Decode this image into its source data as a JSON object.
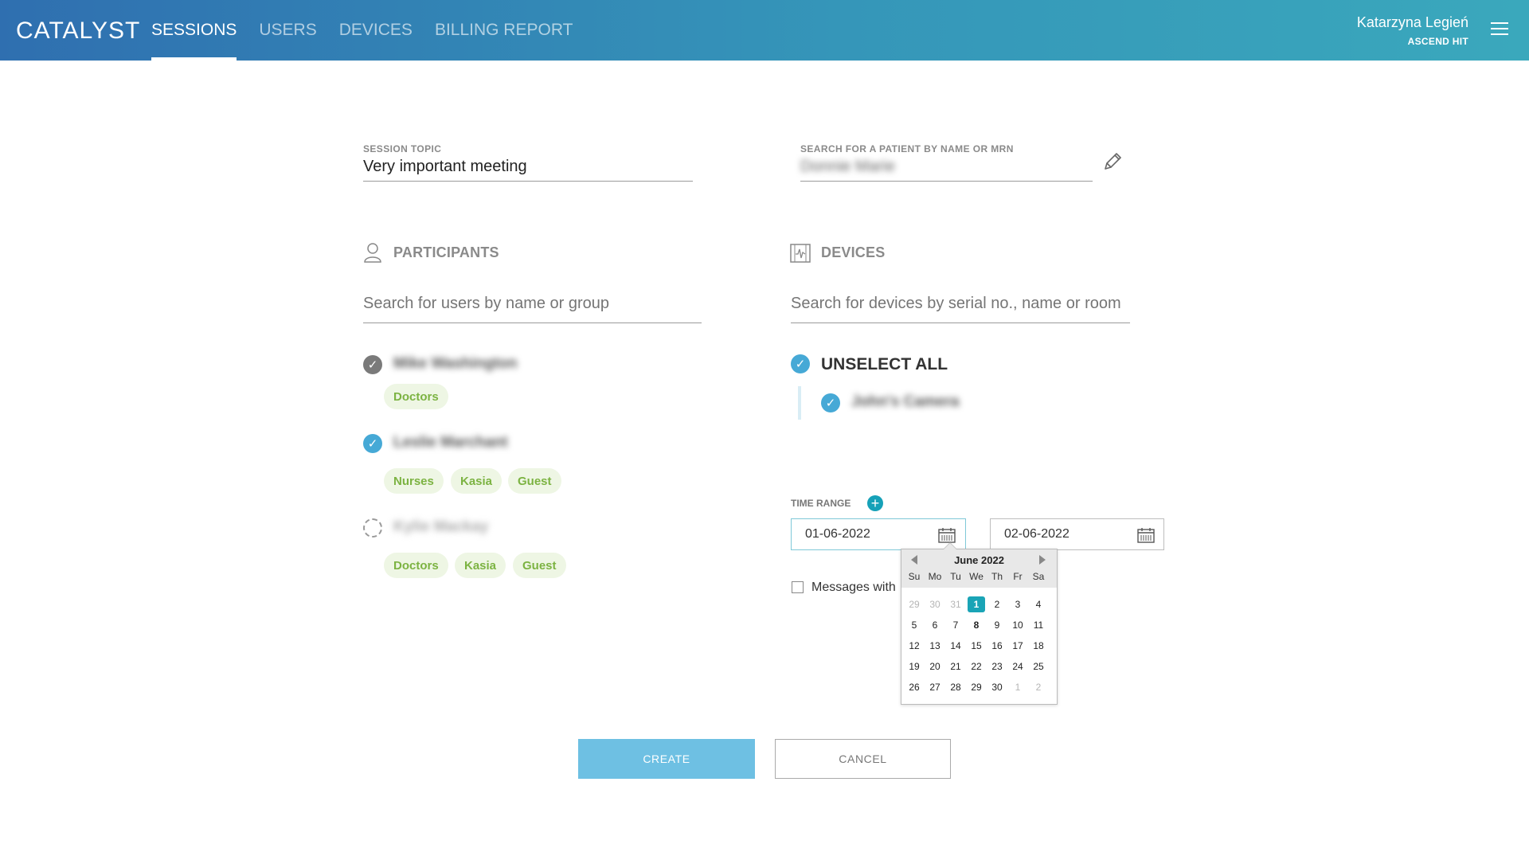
{
  "header": {
    "logo": "CATALYST",
    "nav": [
      "SESSIONS",
      "USERS",
      "DEVICES",
      "BILLING REPORT"
    ],
    "active_nav": "SESSIONS",
    "user_name": "Katarzyna Legień",
    "user_org": "ASCEND HIT"
  },
  "session": {
    "topic_label": "SESSION TOPIC",
    "topic_value": "Very important meeting",
    "patient_label": "SEARCH FOR A PATIENT BY NAME OR MRN",
    "patient_value": "Donnie Marie"
  },
  "participants": {
    "title": "PARTICIPANTS",
    "search_placeholder": "Search for users by name or group",
    "people": [
      {
        "name": "Mike Washington",
        "state": "checked-grey",
        "tags": [
          "Doctors"
        ]
      },
      {
        "name": "Leslie Marchant",
        "state": "checked-blue",
        "tags": [
          "Nurses",
          "Kasia",
          "Guest"
        ]
      },
      {
        "name": "Kylie Mackay",
        "state": "unchecked",
        "tags": [
          "Doctors",
          "Kasia",
          "Guest"
        ]
      }
    ]
  },
  "devices": {
    "title": "DEVICES",
    "search_placeholder": "Search for devices by serial no., name or room",
    "unselect_all": "UNSELECT ALL",
    "items": [
      {
        "name": "John's Camera",
        "checked": true
      }
    ]
  },
  "time_range": {
    "label": "TIME RANGE",
    "start": "01-06-2022",
    "end": "02-06-2022",
    "messages_label": "Messages with"
  },
  "calendar": {
    "month": "June 2022",
    "weekdays": [
      "Su",
      "Mo",
      "Tu",
      "We",
      "Th",
      "Fr",
      "Sa"
    ],
    "weeks": [
      [
        "29",
        "30",
        "31",
        "1",
        "2",
        "3",
        "4"
      ],
      [
        "5",
        "6",
        "7",
        "8",
        "9",
        "10",
        "11"
      ],
      [
        "12",
        "13",
        "14",
        "15",
        "16",
        "17",
        "18"
      ],
      [
        "19",
        "20",
        "21",
        "22",
        "23",
        "24",
        "25"
      ],
      [
        "26",
        "27",
        "28",
        "29",
        "30",
        "1",
        "2"
      ]
    ],
    "selected_day": "1",
    "today_day": "8"
  },
  "actions": {
    "create": "CREATE",
    "cancel": "CANCEL"
  },
  "colors": {
    "header_gradient_start": "#2f6fb0",
    "header_gradient_end": "#3aa8bc",
    "accent": "#46a9d6",
    "tag_text": "#7cb342",
    "tag_bg": "#eef6e4",
    "create_button": "#6ec0e3"
  }
}
